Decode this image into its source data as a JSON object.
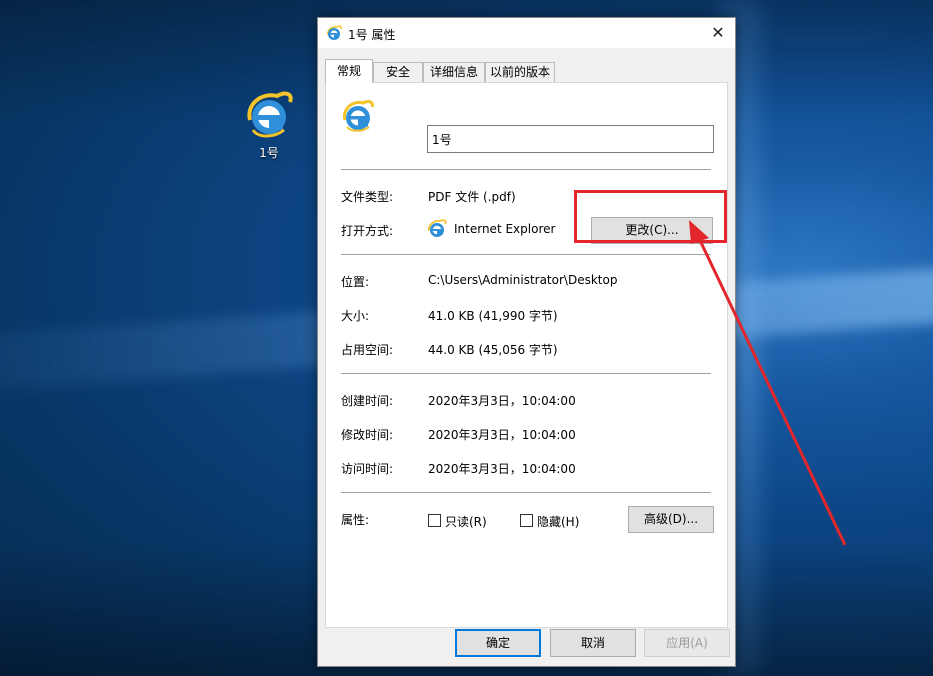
{
  "desktop": {
    "icon_label": "1号"
  },
  "dialog": {
    "title": "1号 属性",
    "close_glyph": "✕",
    "tabs": [
      {
        "label": "常规"
      },
      {
        "label": "安全"
      },
      {
        "label": "详细信息"
      },
      {
        "label": "以前的版本"
      }
    ],
    "general": {
      "file_name": "1号",
      "file_type_label": "文件类型:",
      "file_type_value": "PDF 文件 (.pdf)",
      "opens_with_label": "打开方式:",
      "opens_with_value": "Internet Explorer",
      "change_button": "更改(C)...",
      "location_label": "位置:",
      "location_value": "C:\\Users\\Administrator\\Desktop",
      "size_label": "大小:",
      "size_value": "41.0 KB (41,990 字节)",
      "size_on_disk_label": "占用空间:",
      "size_on_disk_value": "44.0 KB (45,056 字节)",
      "created_label": "创建时间:",
      "created_value": "2020年3月3日，10:04:00",
      "modified_label": "修改时间:",
      "modified_value": "2020年3月3日，10:04:00",
      "accessed_label": "访问时间:",
      "accessed_value": "2020年3月3日，10:04:00",
      "attributes_label": "属性:",
      "readonly_label": "只读(R)",
      "readonly_checked": false,
      "hidden_label": "隐藏(H)",
      "hidden_checked": false,
      "advanced_button": "高级(D)..."
    },
    "footer": {
      "ok": "确定",
      "cancel": "取消",
      "apply": "应用(A)"
    }
  },
  "annotation": {
    "color": "#e3262b"
  },
  "icons": {
    "file_icon": "internet-explorer-icon"
  }
}
